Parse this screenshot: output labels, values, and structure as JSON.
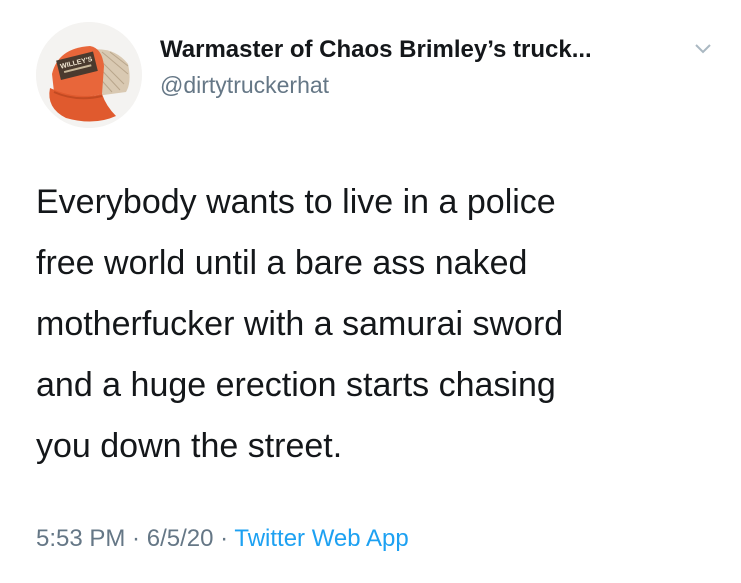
{
  "user": {
    "display_name": "Warmaster of Chaos Brimley’s truck...",
    "handle": "@dirtytruckerhat",
    "avatar_icon": "trucker-hat-avatar-icon",
    "menu_icon": "chevron-down-icon",
    "hat_patch_text": "WILLEY'S"
  },
  "tweet": {
    "lines": [
      "Everybody wants to live in a police",
      "free world until a bare ass naked",
      "motherfucker with a samurai sword",
      "and a huge erection starts chasing",
      "you down the street."
    ]
  },
  "meta": {
    "time": "5:53 PM",
    "separator": " · ",
    "date": "6/5/20",
    "app": "Twitter Web App"
  },
  "colors": {
    "text": "#14171a",
    "secondary": "#657786",
    "link": "#1da1f2",
    "hat_orange": "#e8663a"
  }
}
